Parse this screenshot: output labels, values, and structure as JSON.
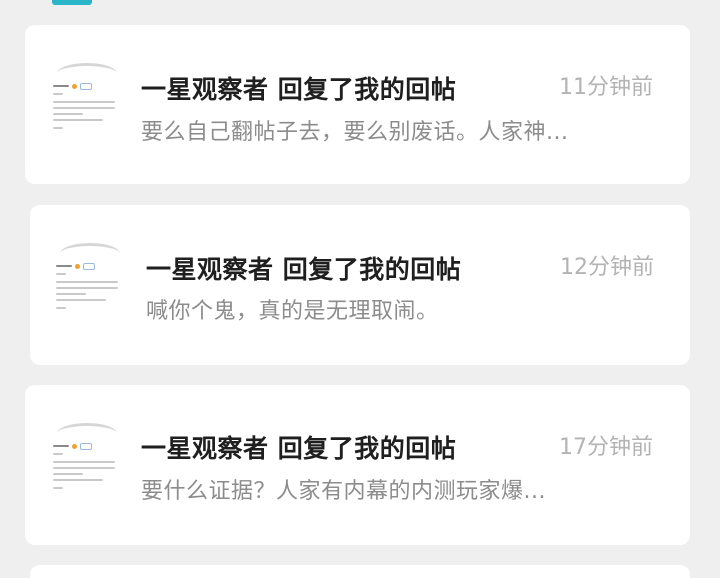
{
  "notifications": [
    {
      "title": "一星观察者 回复了我的回帖",
      "time": "11分钟前",
      "snippet": "要么自己翻帖子去，要么别废话。人家神..."
    },
    {
      "title": "一星观察者 回复了我的回帖",
      "time": "12分钟前",
      "snippet": "喊你个鬼，真的是无理取闹。"
    },
    {
      "title": "一星观察者 回复了我的回帖",
      "time": "17分钟前",
      "snippet": "要什么证据？人家有内幕的内测玩家爆..."
    }
  ],
  "colors": {
    "accent": "#2bb5c8",
    "background": "#efefef",
    "card": "#ffffff"
  }
}
